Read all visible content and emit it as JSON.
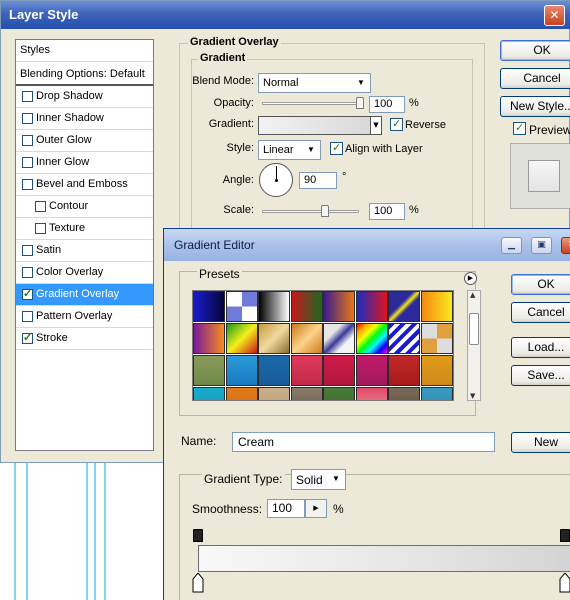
{
  "layer_style": {
    "title": "Layer Style",
    "styles_panel": {
      "header": "Styles",
      "blending_options": "Blending Options: Default",
      "items": [
        {
          "label": "Drop Shadow",
          "checked": false,
          "sub": false
        },
        {
          "label": "Inner Shadow",
          "checked": false,
          "sub": false
        },
        {
          "label": "Outer Glow",
          "checked": false,
          "sub": false
        },
        {
          "label": "Inner Glow",
          "checked": false,
          "sub": false
        },
        {
          "label": "Bevel and Emboss",
          "checked": false,
          "sub": false
        },
        {
          "label": "Contour",
          "checked": false,
          "sub": true
        },
        {
          "label": "Texture",
          "checked": false,
          "sub": true
        },
        {
          "label": "Satin",
          "checked": false,
          "sub": false
        },
        {
          "label": "Color Overlay",
          "checked": false,
          "sub": false
        },
        {
          "label": "Gradient Overlay",
          "checked": true,
          "sub": false,
          "selected": true
        },
        {
          "label": "Pattern Overlay",
          "checked": false,
          "sub": false
        },
        {
          "label": "Stroke",
          "checked": true,
          "sub": false
        }
      ]
    },
    "gradient_overlay": {
      "group_title": "Gradient Overlay",
      "sub_group_title": "Gradient",
      "blend_mode_label": "Blend Mode:",
      "blend_mode_value": "Normal",
      "opacity_label": "Opacity:",
      "opacity_value": "100",
      "opacity_unit": "%",
      "opacity_level": 1.0,
      "gradient_label": "Gradient:",
      "reverse_label": "Reverse",
      "reverse_checked": true,
      "style_label": "Style:",
      "style_value": "Linear",
      "align_label": "Align with Layer",
      "align_checked": true,
      "angle_label": "Angle:",
      "angle_value": "90",
      "angle_unit": "°",
      "scale_label": "Scale:",
      "scale_value": "100",
      "scale_unit": "%",
      "scale_level": 0.67
    },
    "buttons": {
      "ok": "OK",
      "cancel": "Cancel",
      "new_style": "New Style...",
      "preview": "Preview"
    },
    "preview_checked": true
  },
  "gradient_editor": {
    "title": "Gradient Editor",
    "presets_label": "Presets",
    "buttons": {
      "ok": "OK",
      "cancel": "Cancel",
      "load": "Load...",
      "save": "Save...",
      "new": "New"
    },
    "name_label": "Name:",
    "name_value": "Cream",
    "gradient_type_label": "Gradient Type:",
    "gradient_type_value": "Solid",
    "smoothness_label": "Smoothness:",
    "smoothness_value": "100",
    "smoothness_unit": "%",
    "preset_swatches": [
      "linear-gradient(to right,#1b1bcf,#05053a)",
      "conic-gradient(#6e7bd8 25%,#fff 0 50%,#6e7bd8 0 75%,#fff 0)",
      "linear-gradient(to right,#000,#fff)",
      "linear-gradient(to right,#c71919,#1a6a22)",
      "linear-gradient(to right,#3c1b8e,#e87717)",
      "linear-gradient(to right,#1a2cc1,#e0141e)",
      "linear-gradient(135deg,#2a2a9a 40%,#f5e01a 50%,#2a2a9a 60%)",
      "linear-gradient(to right,#f28a13,#fbe81d)",
      "linear-gradient(to right,#7b1a9a,#f58b1d)",
      "linear-gradient(135deg,#1a9a1a,#f5f01a,#c71919)",
      "linear-gradient(135deg,#c69a3b,#f0d9a0,#8a6a2a)",
      "linear-gradient(135deg,#c97a1b,#ffd28a,#c97a1b)",
      "linear-gradient(135deg,#e6e6e6 30%,#3a3a9a 50%,#f3f3f3 70%)",
      "linear-gradient(135deg,red,orange,yellow,lime,cyan,blue,magenta)",
      "repeating-linear-gradient(135deg,#1b1bcf 0 4px,#fff 4px 8px)",
      "conic-gradient(#e0a040 25%,#ddd 0 50%,#e0a040 0 75%,#ddd 0)",
      "linear-gradient(#8a9a5a,#6f8a48)",
      "linear-gradient(#2a9ad8,#1a7ac0)",
      "linear-gradient(#1a6aa8,#1a5a98)",
      "linear-gradient(#e03a5a,#c02a4a)",
      "linear-gradient(#d01a4a,#b0183a)",
      "linear-gradient(#c21a6a,#a01a5a)",
      "linear-gradient(#c02a2a,#a81a1a)",
      "linear-gradient(#e09a1a,#d08a1a)",
      "linear-gradient(#1aaaca,#1a9aba)",
      "linear-gradient(#e07a1a,#d06a10)",
      "linear-gradient(#c9b08a,#b89a70)",
      "linear-gradient(#8a7a6a,#6a5a4a)",
      "linear-gradient(#4a7a3a,#3a6a2a)",
      "linear-gradient(#e04a6a,#f09a9a)",
      "linear-gradient(#7a6a5a,#5a4a3a)",
      "linear-gradient(#3a9ac0,#2a8ab0)"
    ]
  }
}
